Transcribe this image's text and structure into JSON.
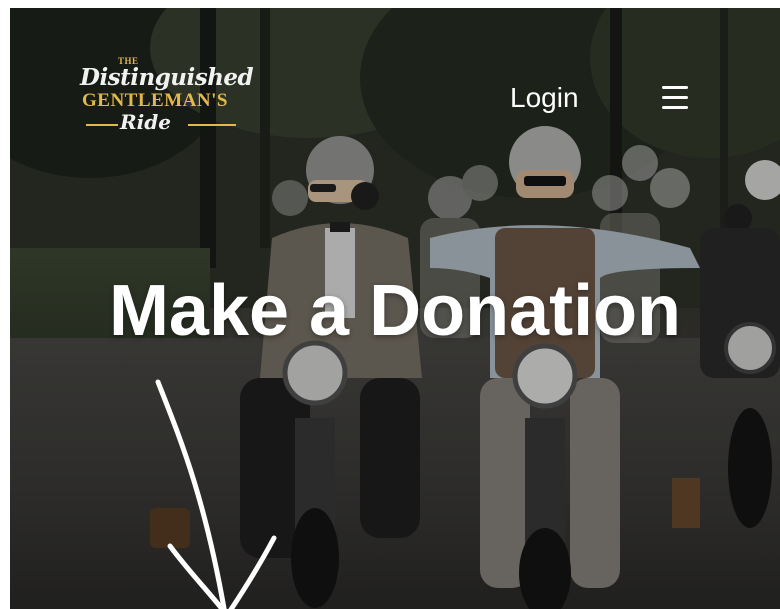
{
  "header": {
    "logo": {
      "line1": "THE",
      "line2": "Distinguished",
      "line3": "GENTLEMAN'S",
      "line4": "Ride",
      "gold": "#e3b94a"
    },
    "login_label": "Login",
    "menu_icon": "hamburger-menu-icon"
  },
  "hero": {
    "title": "Make a Donation",
    "background": "photo of helmeted riders on classic motorcycles on a tree-lined road",
    "arrow_icon": "hand-drawn-down-arrow-icon"
  }
}
